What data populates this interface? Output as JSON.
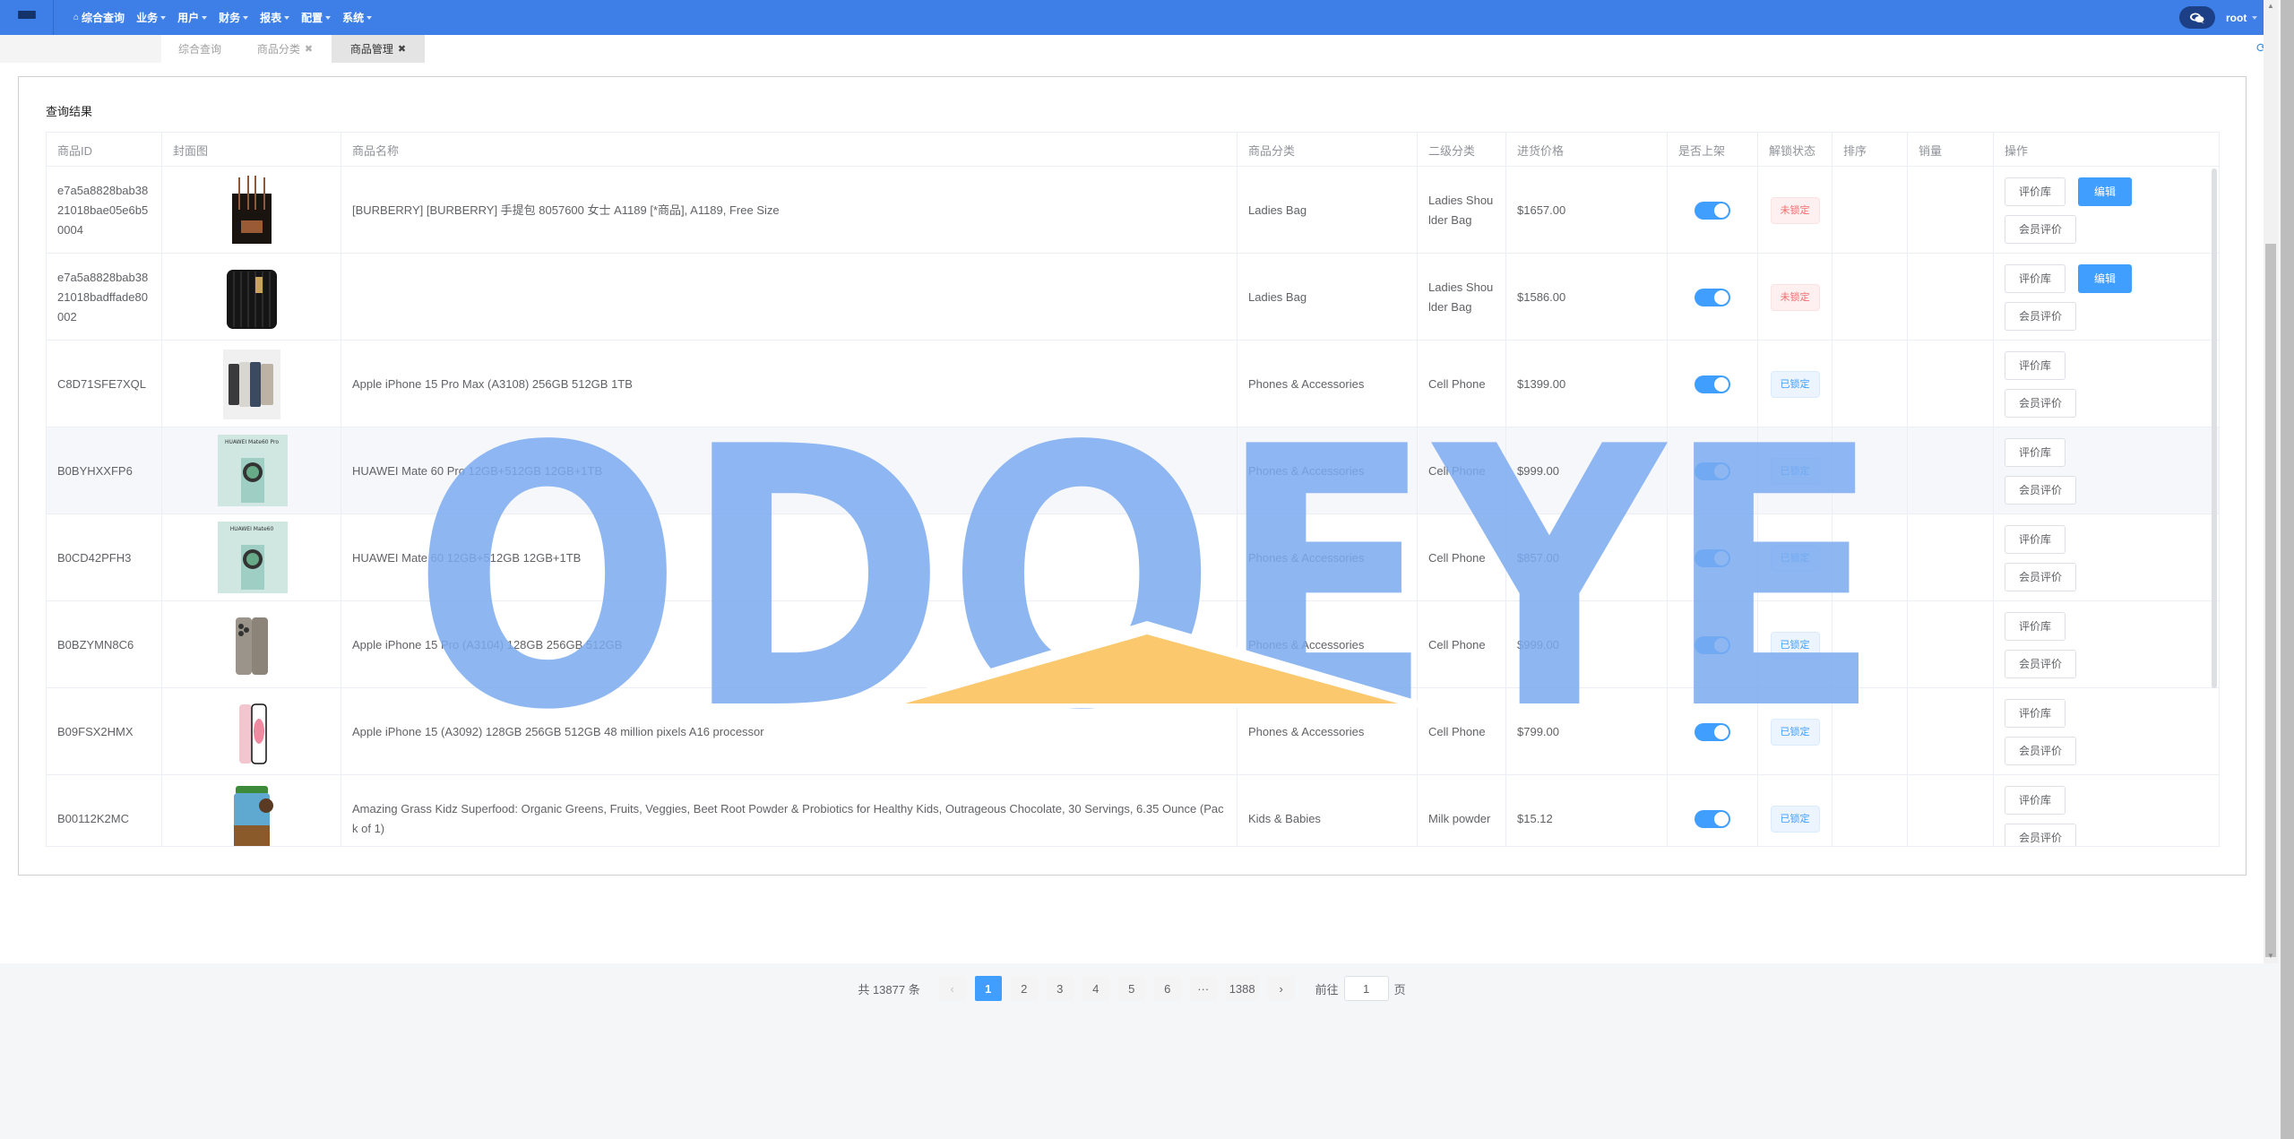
{
  "topbar": {
    "menu_icon": "hamburger-icon",
    "nav": [
      {
        "label": "综合查询",
        "icon": "home-icon",
        "has_caret": false
      },
      {
        "label": "业务",
        "has_caret": true
      },
      {
        "label": "用户",
        "has_caret": true
      },
      {
        "label": "财务",
        "has_caret": true
      },
      {
        "label": "报表",
        "has_caret": true
      },
      {
        "label": "配置",
        "has_caret": true
      },
      {
        "label": "系统",
        "has_caret": true
      }
    ],
    "chat_icon": "chat-bubbles-icon",
    "user": "root"
  },
  "tabs": [
    {
      "label": "综合查询",
      "closable": false,
      "active": false
    },
    {
      "label": "商品分类",
      "closable": true,
      "active": false
    },
    {
      "label": "商品管理",
      "closable": true,
      "active": true
    }
  ],
  "tab_close_glyph": "✖",
  "refresh_icon": "refresh-icon",
  "panel": {
    "title": "查询结果"
  },
  "table": {
    "columns": [
      "商品ID",
      "封面图",
      "商品名称",
      "商品分类",
      "二级分类",
      "进货价格",
      "是否上架",
      "解锁状态",
      "排序",
      "销量",
      "操作"
    ],
    "rows": [
      {
        "id": "e7a5a8828bab3821018bae05e6b50004",
        "image": "burberry-tote-bag",
        "name": "[BURBERRY] [BURBERRY] 手提包 8057600 女士 A1189 [*商品], A1189, Free Size",
        "category": "Ladies Bag",
        "subcategory": "Ladies Shoulder Bag",
        "price": "$1657.00",
        "on_shelf": true,
        "lock_status": "未锁定",
        "locked": false,
        "sort": "",
        "sales": "",
        "actions": [
          "评价库",
          "编辑",
          "会员评价"
        ]
      },
      {
        "id": "e7a5a8828bab3821018badffade80002",
        "image": "burberry-quilted-bag",
        "name": "",
        "category": "Ladies Bag",
        "subcategory": "Ladies Shoulder Bag",
        "price": "$1586.00",
        "on_shelf": true,
        "lock_status": "未锁定",
        "locked": false,
        "sort": "",
        "sales": "",
        "actions": [
          "评价库",
          "编辑",
          "会员评价"
        ]
      },
      {
        "id": "C8D71SFE7XQL",
        "image": "iphone-15-pro-max",
        "name": "Apple iPhone 15 Pro Max (A3108) 256GB 512GB 1TB",
        "category": "Phones & Accessories",
        "subcategory": "Cell Phone",
        "price": "$1399.00",
        "on_shelf": true,
        "lock_status": "已锁定",
        "locked": true,
        "sort": "",
        "sales": "",
        "actions": [
          "评价库",
          "会员评价"
        ]
      },
      {
        "id": "B0BYHXXFP6",
        "image": "huawei-mate-60-pro",
        "name": "HUAWEI Mate 60 Pro 12GB+512GB 12GB+1TB",
        "category": "Phones & Accessories",
        "subcategory": "Cell Phone",
        "price": "$999.00",
        "on_shelf": true,
        "lock_status": "已锁定",
        "locked": true,
        "sort": "",
        "sales": "",
        "actions": [
          "评价库",
          "会员评价"
        ]
      },
      {
        "id": "B0CD42PFH3",
        "image": "huawei-mate-60",
        "name": "HUAWEI Mate 60 12GB+512GB 12GB+1TB",
        "category": "Phones & Accessories",
        "subcategory": "Cell Phone",
        "price": "$857.00",
        "on_shelf": true,
        "lock_status": "已锁定",
        "locked": true,
        "sort": "",
        "sales": "",
        "actions": [
          "评价库",
          "会员评价"
        ]
      },
      {
        "id": "B0BZYMN8C6",
        "image": "iphone-15-pro",
        "name": "Apple iPhone 15 Pro (A3104) 128GB 256GB 512GB",
        "category": "Phones & Accessories",
        "subcategory": "Cell Phone",
        "price": "$999.00",
        "on_shelf": true,
        "lock_status": "已锁定",
        "locked": true,
        "sort": "",
        "sales": "",
        "actions": [
          "评价库",
          "会员评价"
        ]
      },
      {
        "id": "B09FSX2HMX",
        "image": "iphone-15-pink",
        "name": "Apple iPhone 15 (A3092) 128GB 256GB 512GB 48 million pixels A16 processor",
        "category": "Phones & Accessories",
        "subcategory": "Cell Phone",
        "price": "$799.00",
        "on_shelf": true,
        "lock_status": "已锁定",
        "locked": true,
        "sort": "",
        "sales": "",
        "actions": [
          "评价库",
          "会员评价"
        ]
      },
      {
        "id": "B00112K2MC",
        "image": "amazing-grass-kidz-superfood",
        "name": "Amazing Grass Kidz Superfood: Organic Greens, Fruits, Veggies, Beet Root Powder & Probiotics for Healthy Kids, Outrageous Chocolate, 30 Servings, 6.35 Ounce (Pack of 1)",
        "category": "Kids & Babies",
        "subcategory": "Milk powder",
        "price": "$15.12",
        "on_shelf": true,
        "lock_status": "已锁定",
        "locked": true,
        "sort": "",
        "sales": "",
        "actions": [
          "评价库",
          "会员评价"
        ]
      }
    ]
  },
  "pagination": {
    "total_label": "共 13877 条",
    "prev": "‹",
    "next": "›",
    "pages": [
      "1",
      "2",
      "3",
      "4",
      "5",
      "6",
      "···",
      "1388"
    ],
    "current": "1",
    "goto_label": "前往",
    "goto_value": "1",
    "page_suffix": "页"
  },
  "watermark": {
    "text": "ODOEYE",
    "text_color": "#7aaaf0",
    "roof_color": "#fcc86e"
  },
  "colors": {
    "topbar": "#3d7fe6",
    "primary": "#409eff",
    "danger": "#f56c6c"
  }
}
